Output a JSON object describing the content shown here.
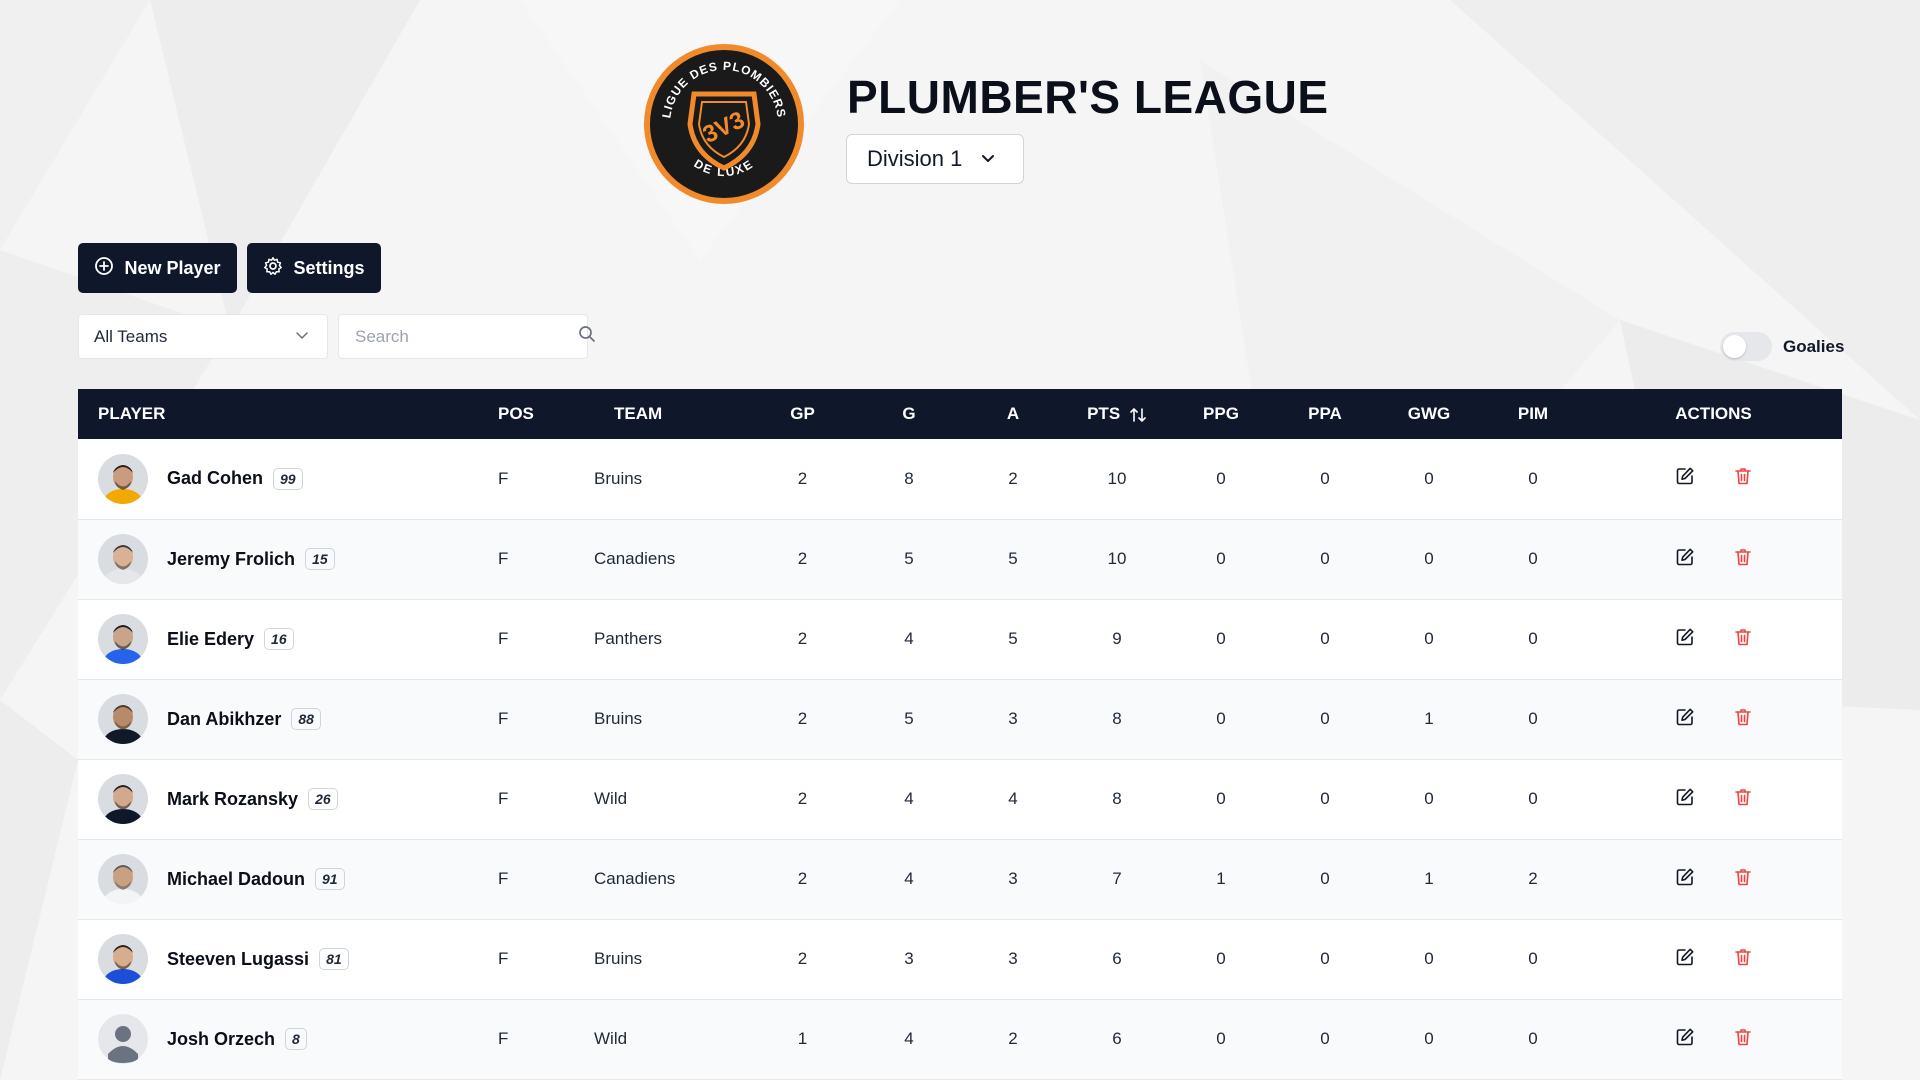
{
  "header": {
    "logo": {
      "ring_text_top": "LIGUE DES PLOMBIERS",
      "ring_text_bottom": "DE LUXE",
      "shield_text": "3V3",
      "ring_color": "#f18a2b",
      "inner_color": "#1a1a1a"
    },
    "title": "PLUMBER'S LEAGUE",
    "division": "Division 1"
  },
  "toolbar": {
    "new_player_label": "New Player",
    "settings_label": "Settings"
  },
  "filters": {
    "team": "All Teams",
    "search_placeholder": "Search",
    "goalies_label": "Goalies",
    "goalies_on": false
  },
  "table": {
    "columns": [
      "PLAYER",
      "POS",
      "TEAM",
      "GP",
      "G",
      "A",
      "PTS",
      "PPG",
      "PPA",
      "GWG",
      "PIM",
      "ACTIONS"
    ],
    "sorted_by": "PTS",
    "rows": [
      {
        "name": "Gad Cohen",
        "number": "99",
        "pos": "F",
        "team": "Bruins",
        "gp": "2",
        "g": "8",
        "a": "2",
        "pts": "10",
        "ppg": "0",
        "ppa": "0",
        "gwg": "0",
        "pim": "0",
        "avatar": "photo"
      },
      {
        "name": "Jeremy Frolich",
        "number": "15",
        "pos": "F",
        "team": "Canadiens",
        "gp": "2",
        "g": "5",
        "a": "5",
        "pts": "10",
        "ppg": "0",
        "ppa": "0",
        "gwg": "0",
        "pim": "0",
        "avatar": "photo"
      },
      {
        "name": "Elie Edery",
        "number": "16",
        "pos": "F",
        "team": "Panthers",
        "gp": "2",
        "g": "4",
        "a": "5",
        "pts": "9",
        "ppg": "0",
        "ppa": "0",
        "gwg": "0",
        "pim": "0",
        "avatar": "photo"
      },
      {
        "name": "Dan Abikhzer",
        "number": "88",
        "pos": "F",
        "team": "Bruins",
        "gp": "2",
        "g": "5",
        "a": "3",
        "pts": "8",
        "ppg": "0",
        "ppa": "0",
        "gwg": "1",
        "pim": "0",
        "avatar": "photo"
      },
      {
        "name": "Mark Rozansky",
        "number": "26",
        "pos": "F",
        "team": "Wild",
        "gp": "2",
        "g": "4",
        "a": "4",
        "pts": "8",
        "ppg": "0",
        "ppa": "0",
        "gwg": "0",
        "pim": "0",
        "avatar": "photo"
      },
      {
        "name": "Michael Dadoun",
        "number": "91",
        "pos": "F",
        "team": "Canadiens",
        "gp": "2",
        "g": "4",
        "a": "3",
        "pts": "7",
        "ppg": "1",
        "ppa": "0",
        "gwg": "1",
        "pim": "2",
        "avatar": "photo"
      },
      {
        "name": "Steeven Lugassi",
        "number": "81",
        "pos": "F",
        "team": "Bruins",
        "gp": "2",
        "g": "3",
        "a": "3",
        "pts": "6",
        "ppg": "0",
        "ppa": "0",
        "gwg": "0",
        "pim": "0",
        "avatar": "photo"
      },
      {
        "name": "Josh Orzech",
        "number": "8",
        "pos": "F",
        "team": "Wild",
        "gp": "1",
        "g": "4",
        "a": "2",
        "pts": "6",
        "ppg": "0",
        "ppa": "0",
        "gwg": "0",
        "pim": "0",
        "avatar": "placeholder"
      }
    ]
  },
  "colors": {
    "header_bg": "#0f172a",
    "delete_red": "#ef4444",
    "logo_orange": "#f18a2b"
  },
  "icons": {
    "new_player": "plus-circle-icon",
    "settings": "gear-icon",
    "dropdown": "chevron-down-icon",
    "search": "search-icon",
    "sort": "sort-arrows-icon",
    "edit": "edit-icon",
    "delete": "trash-icon"
  }
}
